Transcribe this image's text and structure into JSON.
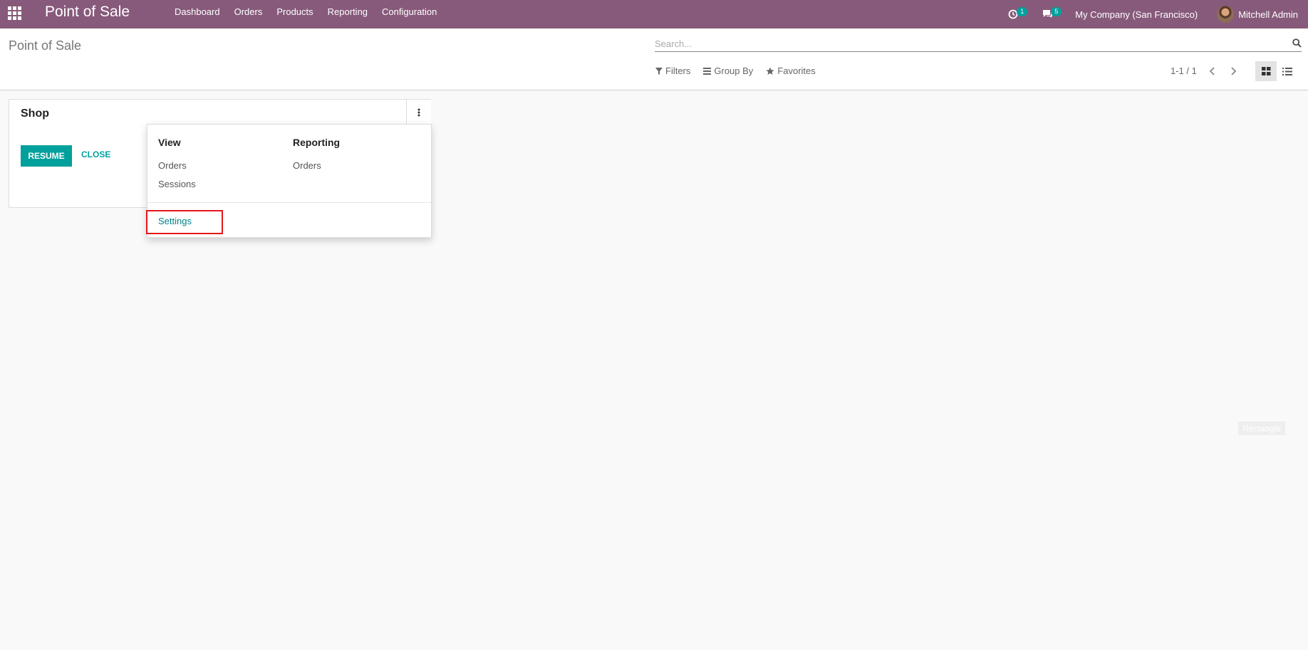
{
  "navbar": {
    "brand": "Point of Sale",
    "menu": [
      "Dashboard",
      "Orders",
      "Products",
      "Reporting",
      "Configuration"
    ],
    "activity_count": "1",
    "messages_count": "5",
    "company": "My Company (San Francisco)",
    "user": "Mitchell Admin"
  },
  "control_panel": {
    "breadcrumb": "Point of Sale",
    "search_placeholder": "Search...",
    "filters_label": "Filters",
    "groupby_label": "Group By",
    "favorites_label": "Favorites",
    "pager": "1-1 / 1"
  },
  "card": {
    "title": "Shop",
    "resume_label": "RESUME",
    "close_label": "CLOSE"
  },
  "dropdown": {
    "view_title": "View",
    "view_items": [
      "Orders",
      "Sessions"
    ],
    "reporting_title": "Reporting",
    "reporting_items": [
      "Orders"
    ],
    "settings_label": "Settings"
  },
  "overlay_label": "Rectangle",
  "colors": {
    "navbar": "#875a7b",
    "accent": "#00a09d",
    "highlight": "#e3171b"
  }
}
